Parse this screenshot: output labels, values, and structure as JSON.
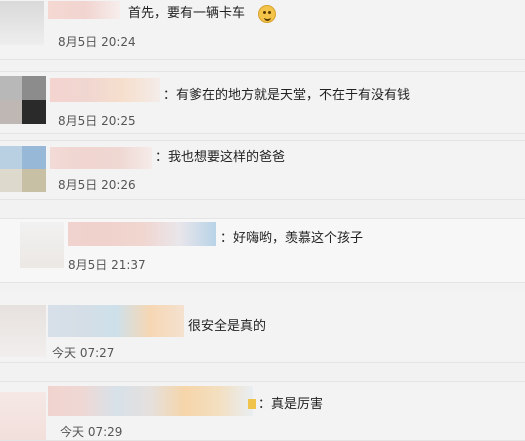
{
  "comments": [
    {
      "text": "首先，要有一辆卡车",
      "time": "8月5日 20:24"
    },
    {
      "text": "：有爹在的地方就是天堂，不在于有没有钱",
      "time": "8月5日 20:25"
    },
    {
      "text": "：我也想要这样的爸爸",
      "time": "8月5日 20:26"
    },
    {
      "text": "：好嗨哟，羡慕这个孩子",
      "time": "8月5日 21:37"
    },
    {
      "text": "很安全是真的",
      "time": "今天 07:27"
    },
    {
      "text": "：真是厉害",
      "time": "今天 07:29"
    }
  ],
  "icons": {
    "emoji": "grinning-face-emoji"
  }
}
